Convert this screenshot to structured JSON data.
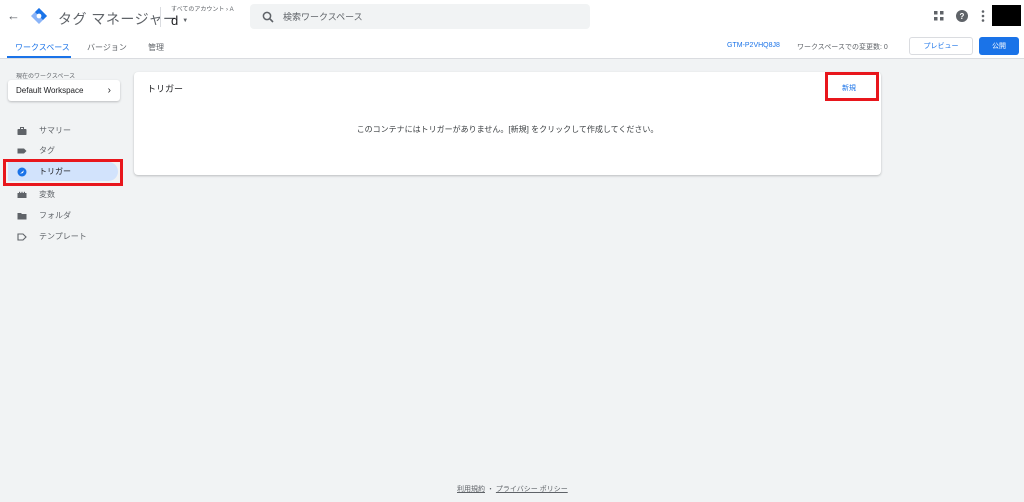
{
  "header": {
    "product_name": "タグ マネージャー",
    "account_path": "すべてのアカウント › A",
    "container_name": "d",
    "search_placeholder": "検索ワークスペース"
  },
  "nav": {
    "tabs": [
      {
        "label": "ワークスペース",
        "active": true
      },
      {
        "label": "バージョン",
        "active": false
      },
      {
        "label": "管理",
        "active": false
      }
    ],
    "container_id": "GTM-P2VHQ8J8",
    "changes_text": "ワークスペースでの変更数: 0",
    "preview_label": "プレビュー",
    "publish_label": "公開"
  },
  "sidebar": {
    "workspace_heading": "現在のワークスペース",
    "workspace_name": "Default Workspace",
    "items": [
      {
        "label": "サマリー",
        "icon": "briefcase-icon",
        "active": false
      },
      {
        "label": "タグ",
        "icon": "tag-icon",
        "active": false
      },
      {
        "label": "トリガー",
        "icon": "trigger-icon",
        "active": true
      },
      {
        "label": "変数",
        "icon": "variables-icon",
        "active": false
      },
      {
        "label": "フォルダ",
        "icon": "folder-icon",
        "active": false
      },
      {
        "label": "テンプレート",
        "icon": "template-icon",
        "active": false
      }
    ]
  },
  "main": {
    "card_title": "トリガー",
    "new_label": "新規",
    "empty_message": "このコンテナにはトリガーがありません。[新規] をクリックして作成してください。"
  },
  "footer": {
    "terms": "利用規約",
    "separator": "・",
    "privacy": "プライバシー ポリシー"
  },
  "colors": {
    "accent": "#1a73e8",
    "highlight": "#e8161c",
    "active_bg": "#d2e3fc",
    "page_bg": "#f1f3f4"
  }
}
